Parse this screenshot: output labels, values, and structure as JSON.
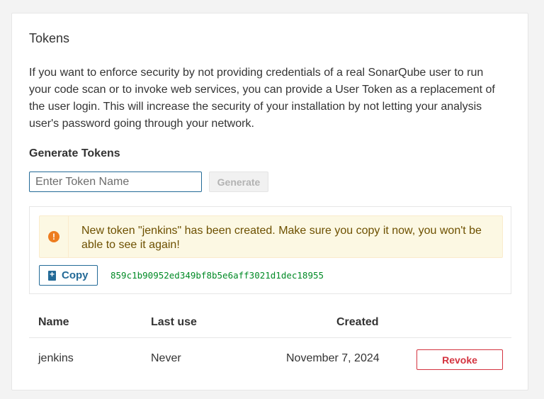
{
  "section": {
    "title": "Tokens",
    "description": "If you want to enforce security by not providing credentials of a real SonarQube user to run your code scan or to invoke web services, you can provide a User Token as a replacement of the user login. This will increase the security of your installation by not letting your analysis user's password going through your network."
  },
  "generate": {
    "title": "Generate Tokens",
    "input_value": "",
    "input_placeholder": "Enter Token Name",
    "button_label": "Generate"
  },
  "new_token": {
    "alert_text": "New token \"jenkins\" has been created. Make sure you copy it now, you won't be able to see it again!",
    "alert_icon": "!",
    "copy_label": "Copy",
    "token_value": "859c1b90952ed349bf8b5e6aff3021d1dec18955"
  },
  "table": {
    "headers": [
      "Name",
      "Last use",
      "Created"
    ],
    "rows": [
      {
        "name": "jenkins",
        "last_use": "Never",
        "created": "November 7, 2024",
        "action_label": "Revoke"
      }
    ]
  },
  "colors": {
    "accent": "#236a97",
    "warning_bg": "#fcf8e3",
    "warning_icon": "#ed7d20",
    "token_text": "#008a25",
    "danger": "#d4333f"
  }
}
